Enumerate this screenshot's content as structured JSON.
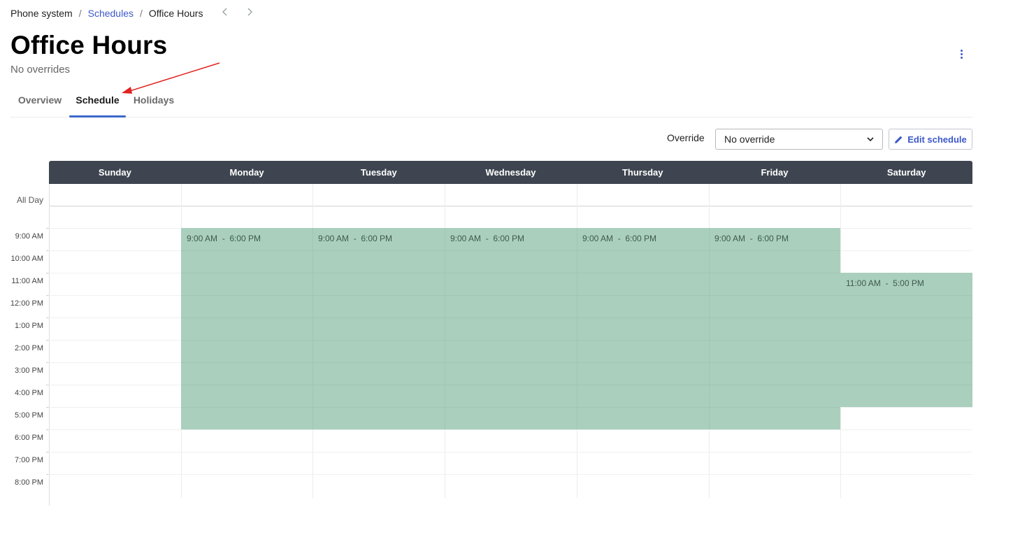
{
  "breadcrumb": {
    "items": [
      "Phone system",
      "Schedules",
      "Office Hours"
    ],
    "separator": "/",
    "prev_icon": "chevron-left-icon",
    "next_icon": "chevron-right-icon"
  },
  "page": {
    "title": "Office Hours",
    "subtitle": "No overrides",
    "menu_icon": "kebab-menu-icon"
  },
  "tabs": [
    {
      "label": "Overview",
      "active": false
    },
    {
      "label": "Schedule",
      "active": true
    },
    {
      "label": "Holidays",
      "active": false
    }
  ],
  "toolbar": {
    "override_label": "Override",
    "override_value": "No override",
    "edit_label": "Edit schedule",
    "edit_icon": "pencil-icon"
  },
  "calendar": {
    "days": [
      "Sunday",
      "Monday",
      "Tuesday",
      "Wednesday",
      "Thursday",
      "Friday",
      "Saturday"
    ],
    "all_day_label": "All Day",
    "time_labels": [
      "9:00 AM",
      "10:00 AM",
      "11:00 AM",
      "12:00 PM",
      "1:00 PM",
      "2:00 PM",
      "3:00 PM",
      "4:00 PM",
      "5:00 PM",
      "6:00 PM",
      "7:00 PM",
      "8:00 PM"
    ],
    "events": [
      {
        "days": [
          "Monday",
          "Tuesday",
          "Wednesday",
          "Thursday",
          "Friday"
        ],
        "start": "9:00 AM",
        "end": "6:00 PM",
        "label": "9:00 AM  -  6:00 PM"
      },
      {
        "days": [
          "Saturday"
        ],
        "start": "11:00 AM",
        "end": "5:00 PM",
        "label": "11:00 AM  -  5:00 PM"
      }
    ],
    "event_color": "#aacfbd",
    "header_color": "#3e4550"
  },
  "colors": {
    "accent": "#3c58c9",
    "annotation_arrow": "#e0231f"
  }
}
